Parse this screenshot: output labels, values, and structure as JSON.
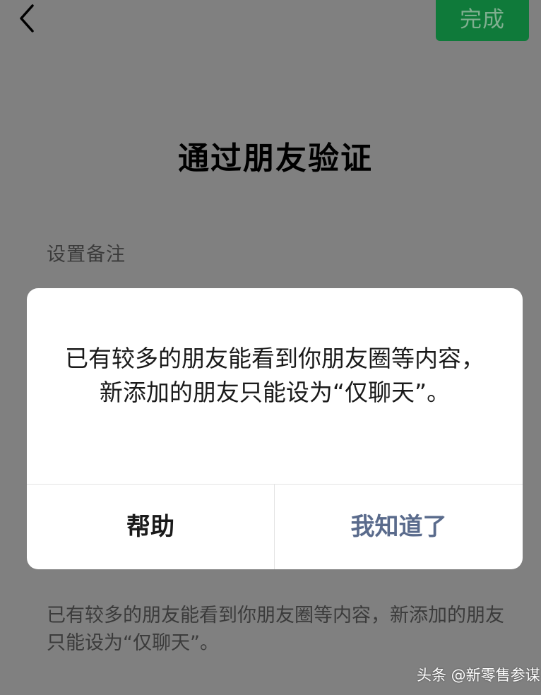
{
  "header": {
    "back_icon": "chevron-left-icon",
    "done_label": "完成"
  },
  "page": {
    "title": "通过朋友验证",
    "remark_label": "设置备注",
    "footer_note": "已有较多的朋友能看到你朋友圈等内容，新添加的朋友只能设为“仅聊天”。"
  },
  "dialog": {
    "message": "已有较多的朋友能看到你朋友圈等内容，新添加的朋友只能设为“仅聊天”。",
    "help_label": "帮助",
    "ok_label": "我知道了"
  },
  "watermark": "头条 @新零售参谋",
  "colors": {
    "accent_green": "#0f7a3a",
    "dialog_ok_text": "#5a6b8c",
    "overlay_background": "#808080"
  }
}
